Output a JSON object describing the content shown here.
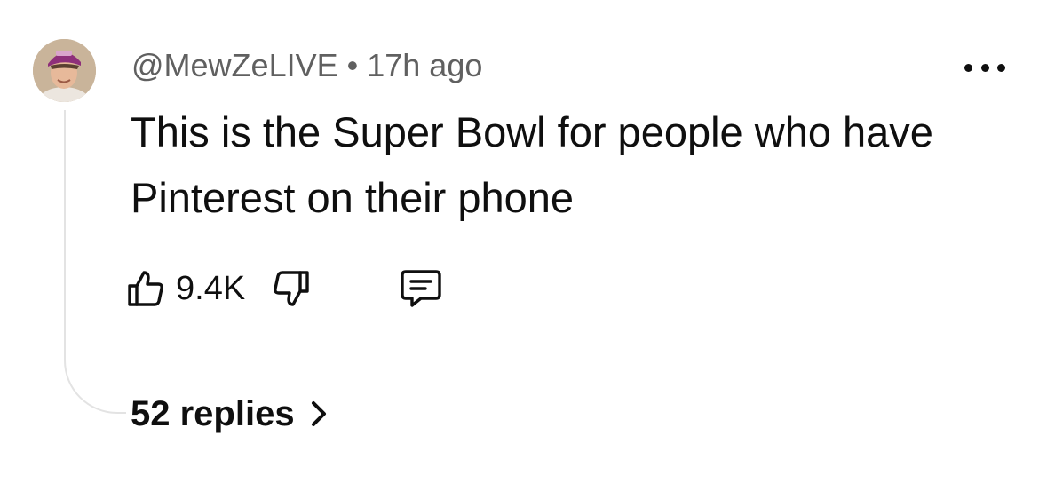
{
  "comment": {
    "author": "@MewZeLIVE",
    "separator": "•",
    "time_ago": "17h ago",
    "text": "This is the Super Bowl for people who have Pinterest on their phone",
    "like_count": "9.4K",
    "replies_label": "52 replies",
    "avatar_icon": "user-avatar-photo",
    "icons": {
      "like": "thumbs-up-icon",
      "dislike": "thumbs-down-icon",
      "reply": "comment-bubble-icon",
      "menu": "more-horizontal-icon",
      "replies": "chevron-right-icon"
    }
  },
  "colors": {
    "text": "#0f0f0f",
    "meta": "#606060",
    "thread_line": "#e3e3e3",
    "background": "#ffffff"
  }
}
